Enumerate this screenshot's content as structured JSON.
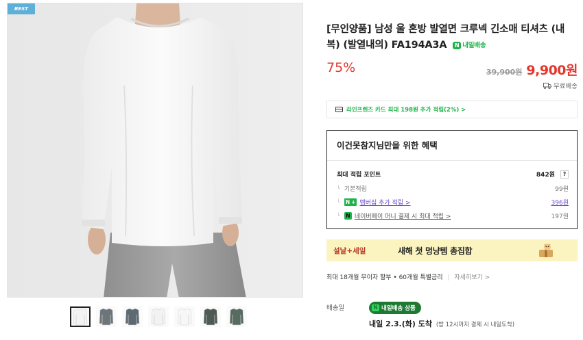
{
  "product": {
    "badge": "BEST",
    "title": "[무인양품] 남성 울 혼방 발열면 크루넥 긴소매 티셔츠 (내복) (발열내의) FA194A3A",
    "next_day_tag": "내일배송",
    "discount_rate": "75%",
    "original_price": "39,900원",
    "sale_price": "9,900원",
    "shipping": "무료배송"
  },
  "card_promo": "라인프렌즈 카드 최대 198원 추가 적립(2%) >",
  "benefits": {
    "title": "이건못참지님만을 위한 혜택",
    "max_points_label": "최대 적립 포인트",
    "max_points_value": "842원",
    "help": "?",
    "rows": [
      {
        "label": "기본적립",
        "value": "99원"
      },
      {
        "label": "멤버십 추가 적립 >",
        "value": "396원"
      },
      {
        "label": "네이버페이 머니 결제 시 최대 적립 >",
        "value": "197원"
      }
    ]
  },
  "banner": {
    "left_text": "설날+세일",
    "main_text": "새해 첫 멍냥템 총집합"
  },
  "installment": {
    "text": "최대 18개월 무이자 할부 • 60개월 특별금리",
    "more": "자세히보기 >"
  },
  "delivery": {
    "label": "배송일",
    "badge": "내일배송 상품",
    "arrival": "내일 2.3.(화) 도착",
    "note": "(밤 12시까지 결제 시 내일도착)"
  },
  "thumbnails": [
    {
      "color": "#f4f4f4",
      "active": true
    },
    {
      "color": "#6e757a",
      "active": false
    },
    {
      "color": "#5e6a72",
      "active": false
    },
    {
      "color": "#f2f2f2",
      "active": false
    },
    {
      "color": "#f7f7f7",
      "active": false
    },
    {
      "color": "#4e5a54",
      "active": false
    },
    {
      "color": "#586b60",
      "active": false
    }
  ],
  "colors": {
    "accent_red": "#e5362c",
    "naver_green": "#20b34a",
    "membership_purple": "#6a46cc",
    "banner_bg": "#fbf4c0"
  }
}
